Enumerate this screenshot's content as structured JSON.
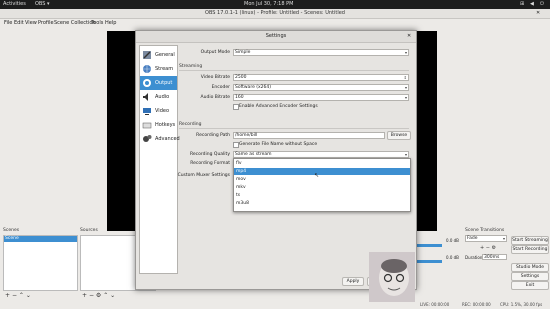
{
  "topbar": {
    "activities": "Activities",
    "app": "OBS ▾",
    "clock": "Mon Jul 30,  7:18 PM"
  },
  "window": {
    "title": "OBS 17.0.1-1 (linux) - Profile: Untitled - Scenes: Untitled"
  },
  "menu": [
    "File",
    "Edit",
    "View",
    "Profile",
    "Scene Collection",
    "Tools",
    "Help"
  ],
  "docks": {
    "scenes_header": "Scenes",
    "scenes": [
      "Scene"
    ],
    "sources_header": "Sources",
    "transitions_header": "Scene Transitions",
    "transition_value": "Fade",
    "duration_label": "Duration",
    "duration_value": "300ms",
    "mixer_db1": "0.0 dB",
    "mixer_db2": "0.0 dB",
    "status_live": "LIVE: 00:00:00",
    "status_rec": "REC: 00:00:00",
    "status_cpu": "CPU: 1.5%, 30.00 fps"
  },
  "controls": [
    "Start Streaming",
    "Start Recording",
    "Settings",
    "Studio Mode",
    "Exit"
  ],
  "dialog": {
    "title": "Settings",
    "categories": [
      "General",
      "Stream",
      "Output",
      "Audio",
      "Video",
      "Hotkeys",
      "Advanced"
    ],
    "selected_category": "Output",
    "output_mode_label": "Output Mode",
    "output_mode": "Simple",
    "streaming_header": "Streaming",
    "video_bitrate_label": "Video Bitrate",
    "video_bitrate": "2500",
    "encoder_label": "Encoder",
    "encoder": "Software (x264)",
    "audio_bitrate_label": "Audio Bitrate",
    "audio_bitrate": "160",
    "adv_encoder_label": "Enable Advanced Encoder Settings",
    "recording_header": "Recording",
    "recording_path_label": "Recording Path",
    "recording_path": "/home/bill",
    "browse": "Browse",
    "gen_filename_label": "Generate File Name without Space",
    "rec_quality_label": "Recording Quality",
    "rec_quality": "Same as stream",
    "rec_format_label": "Recording Format",
    "custom_muxer_label": "Custom Muxer Settings",
    "format_options": [
      "flv",
      "mp4",
      "mov",
      "mkv",
      "ts",
      "m3u8"
    ],
    "format_selected": "mp4",
    "apply": "Apply",
    "cancel": "Cancel",
    "ok": "OK"
  },
  "colors": {
    "accent": "#3d8fd1",
    "preview": "#000000",
    "topbar": "#1d1d1d"
  }
}
